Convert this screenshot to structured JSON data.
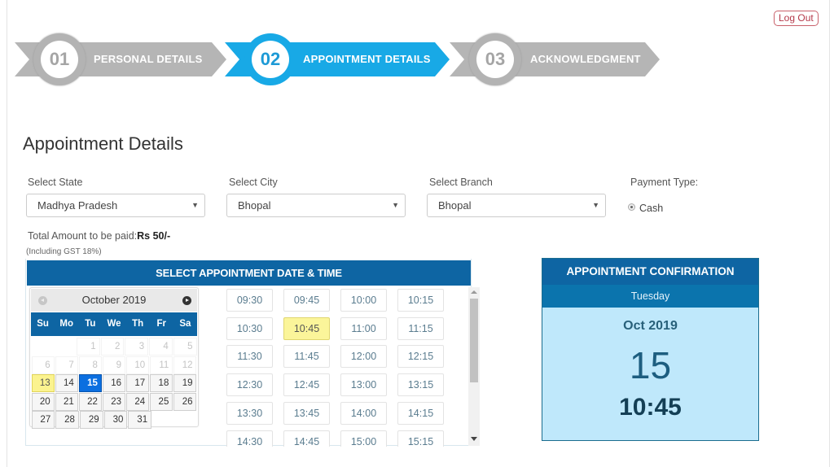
{
  "header": {
    "logout_label": "Log Out"
  },
  "stepper": [
    {
      "number": "01",
      "label": "PERSONAL DETAILS",
      "state": "inactive"
    },
    {
      "number": "02",
      "label": "APPOINTMENT DETAILS",
      "state": "active"
    },
    {
      "number": "03",
      "label": "ACKNOWLEDGMENT",
      "state": "inactive"
    }
  ],
  "page_title": "Appointment Details",
  "form": {
    "state": {
      "label": "Select State",
      "value": "Madhya Pradesh"
    },
    "city": {
      "label": "Select City",
      "value": "Bhopal"
    },
    "branch": {
      "label": "Select Branch",
      "value": "Bhopal"
    },
    "payment": {
      "label": "Payment Type:",
      "option": "Cash",
      "selected": true
    }
  },
  "amount": {
    "prefix": "Total Amount to be paid:",
    "value": "Rs 50/-",
    "note": "(Including GST 18%)"
  },
  "datetime_panel": {
    "header": "SELECT APPOINTMENT DATE & TIME",
    "calendar": {
      "month_label": "October 2019",
      "weekdays": [
        "Su",
        "Mo",
        "Tu",
        "We",
        "Th",
        "Fr",
        "Sa"
      ],
      "weeks": [
        [
          null,
          null,
          1,
          2,
          3,
          4,
          5
        ],
        [
          6,
          7,
          8,
          9,
          10,
          11,
          12
        ],
        [
          13,
          14,
          15,
          16,
          17,
          18,
          19
        ],
        [
          20,
          21,
          22,
          23,
          24,
          25,
          26
        ],
        [
          27,
          28,
          29,
          30,
          31,
          null,
          null
        ]
      ],
      "disabled_before": 13,
      "today": 13,
      "selected": 15
    },
    "time_slots": [
      [
        "09:30",
        "09:45",
        "10:00",
        "10:15"
      ],
      [
        "10:30",
        "10:45",
        "11:00",
        "11:15"
      ],
      [
        "11:30",
        "11:45",
        "12:00",
        "12:15"
      ],
      [
        "12:30",
        "12:45",
        "13:00",
        "13:15"
      ],
      [
        "13:30",
        "13:45",
        "14:00",
        "14:15"
      ],
      [
        "14:30",
        "14:45",
        "15:00",
        "15:15"
      ]
    ],
    "selected_time": "10:45"
  },
  "confirmation": {
    "header": "APPOINTMENT CONFIRMATION",
    "weekday": "Tuesday",
    "month_year": "Oct 2019",
    "day": "15",
    "time": "10:45"
  },
  "colors": {
    "active_step": "#18a9e6",
    "inactive_step": "#b3b3b3",
    "header_blue": "#0e65a3",
    "selected_date": "#0b6fe0",
    "highlight_yellow": "#fbf59a",
    "confirmation_bg": "#bfe8fb",
    "logout": "#b5394a"
  }
}
